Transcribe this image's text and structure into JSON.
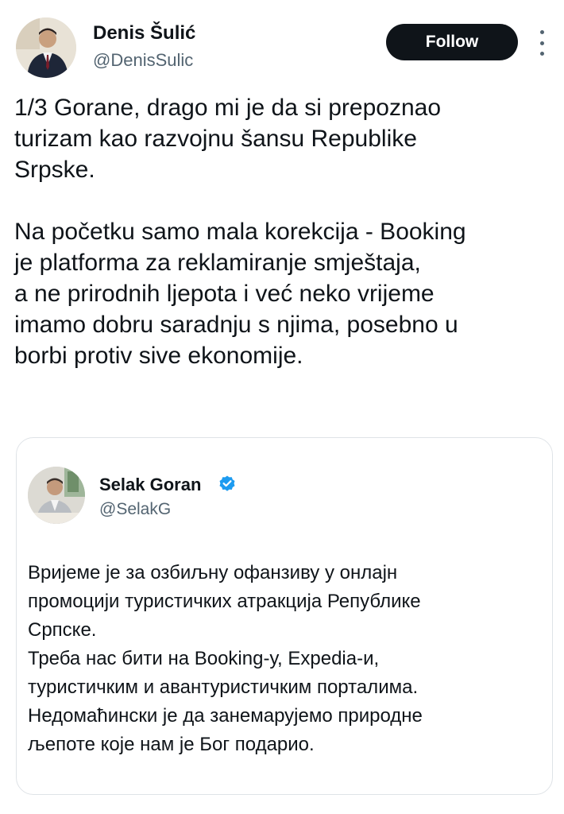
{
  "tweet": {
    "author_name": "Denis Šulić",
    "author_handle": "@DenisSulic",
    "follow_label": "Follow",
    "text": "1/3 Gorane, drago mi je da si prepoznao\nturizam kao razvojnu šansu Republike\nSrpske.\n\nNa početku samo mala korekcija - Booking\nje platforma za reklamiranje smještaja,\na ne prirodnih ljepota i već neko vrijeme\nimamo dobru saradnju s njima, posebno u\nborbi protiv sive ekonomije."
  },
  "quoted_tweet": {
    "author_name": "Selak Goran",
    "author_handle": "@SelakG",
    "verified": true,
    "text": "Вријеме је за озбиљну офанзиву у онлајн\nпромоцији туристичких атракција Републике\nСрпске.\nТреба нас бити на Booking-у, Expedia-и,\nтуристичким и авантуристичким порталима.\nНедомаћински је да занемарујемо природне\nљепоте које нам је Бог подарио."
  },
  "colors": {
    "text_primary": "#0f1419",
    "text_secondary": "#536471",
    "follow_button_bg": "#0f1419",
    "verified_blue": "#1d9bf0",
    "border": "#dfe3e7"
  },
  "icons": {
    "more": "more-vertical-icon",
    "verified": "verified-badge-icon"
  }
}
